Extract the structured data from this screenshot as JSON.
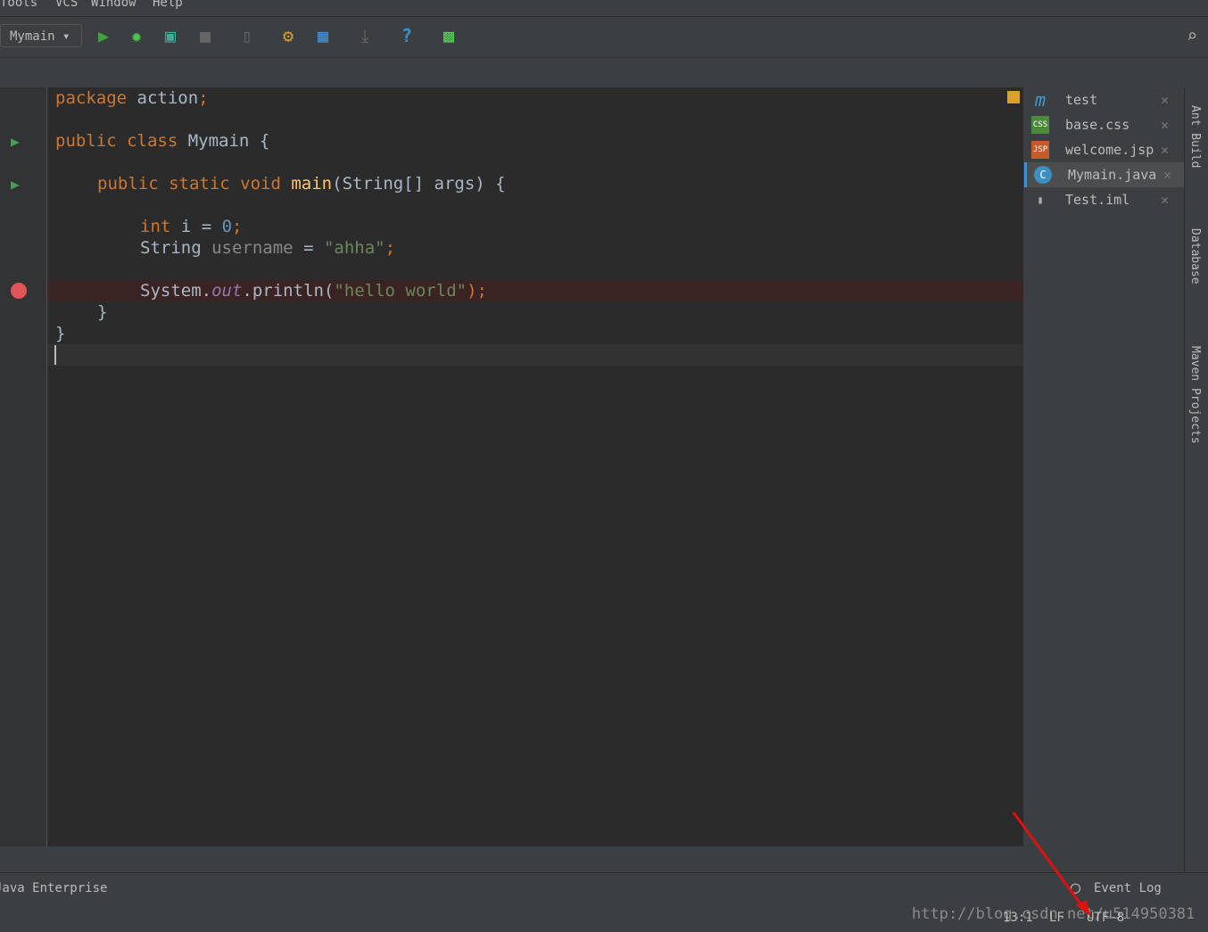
{
  "menu": [
    "Tools",
    "VCS",
    "Window",
    "Help"
  ],
  "toolbar": {
    "run_config": "Mymain",
    "icons": [
      "run-icon",
      "debug-icon",
      "coverage-icon",
      "stop-icon",
      "build-icon",
      "settings-icon",
      "project-structure-icon",
      "update-icon",
      "help-icon",
      "sdk-icon"
    ]
  },
  "code": {
    "l1": [
      "package",
      "action",
      ";"
    ],
    "l2": [
      "public class",
      "Mymain",
      "{"
    ],
    "l3": [
      "public static void",
      "main",
      "(String[] args) {"
    ],
    "l4": [
      "int",
      "i",
      "=",
      "0",
      ";"
    ],
    "l5": [
      "String",
      "username",
      "=",
      "\"ahha\"",
      ";"
    ],
    "l6": [
      "System.",
      "out",
      ".println(",
      "\"hello world\"",
      ");"
    ],
    "l7": "}",
    "l8": "}"
  },
  "tabs": [
    {
      "label": "test",
      "icon": "m"
    },
    {
      "label": "base.css",
      "icon": "CSS"
    },
    {
      "label": "welcome.jsp",
      "icon": "JSP"
    },
    {
      "label": "Mymain.java",
      "icon": "C"
    },
    {
      "label": "Test.iml",
      "icon": "file"
    }
  ],
  "right_tools": [
    "Ant Build",
    "Database",
    "Maven Projects"
  ],
  "bottom": {
    "left": "Java Enterprise",
    "event_log": "Event Log",
    "position": "13:1",
    "line_sep": "LF",
    "encoding": "UTF-8",
    "watermark": "http://blog.csdn.net/u514950381"
  }
}
